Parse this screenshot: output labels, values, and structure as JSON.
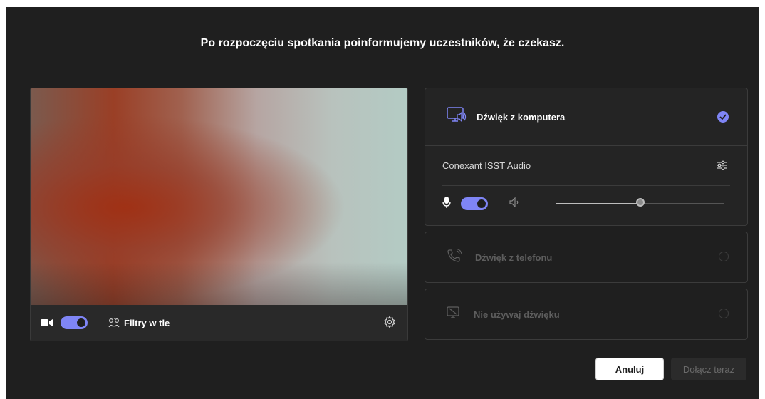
{
  "dialog": {
    "title": "Po rozpoczęciu spotkania poinformujemy uczestników, że czekasz."
  },
  "video": {
    "camera_on": true,
    "filters_label": "Filtry w tle"
  },
  "audio_options": {
    "computer": {
      "label": "Dźwięk z komputera",
      "selected": true,
      "device_name": "Conexant ISST Audio",
      "mic_on": true,
      "speaker_volume_percent": 50
    },
    "phone": {
      "label": "Dźwięk z telefonu",
      "selected": false
    },
    "none": {
      "label": "Nie używaj dźwięku",
      "selected": false
    }
  },
  "buttons": {
    "cancel": "Anuluj",
    "join": "Dołącz teraz"
  },
  "colors": {
    "accent": "#7f85f5",
    "background": "#1f1f1f"
  }
}
